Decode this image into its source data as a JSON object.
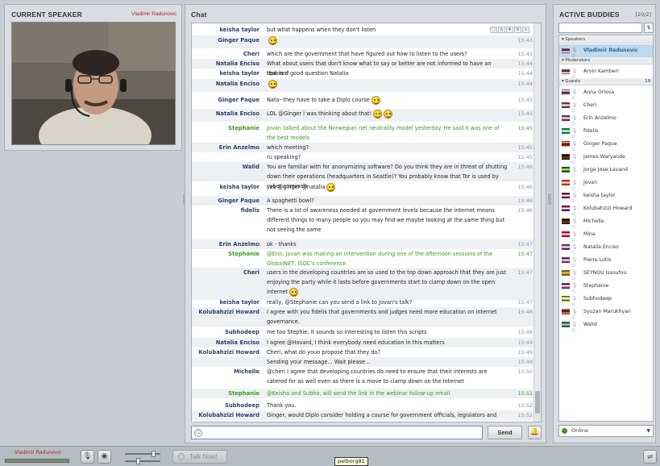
{
  "speaker_panel": {
    "title": "CURRENT SPEAKER",
    "speaker_name": "Vladimir Radunovic"
  },
  "chat_panel": {
    "title": "Chat",
    "send_label": "Send",
    "messages": [
      {
        "name": "keisha taylor",
        "text": "but what happens when they don't listen",
        "time": "",
        "style": "normal"
      },
      {
        "name": "Ginger Paque",
        "text": "",
        "smileys": 1,
        "time": "15:43",
        "style": "normal"
      },
      {
        "name": "Cheri",
        "text": "which are the government that have figured out how to listen to the users?",
        "time": "15:43",
        "style": "normal"
      },
      {
        "name": "Natalia Enciso",
        "text": "What about users that don't know what to say or better are not informed to have an opinion?",
        "time": "15:44",
        "style": "normal"
      },
      {
        "name": "keisha taylor",
        "text": "that is a good question Natalia",
        "time": "15:44",
        "style": "normal"
      },
      {
        "name": "Natalia Enciso",
        "text": "",
        "smileys": 1,
        "time": "15:44",
        "style": "normal"
      },
      {
        "name": "Ginger Paque",
        "text": "Nata--they have to take a Diplo course",
        "smileys": 1,
        "time": "15:45",
        "style": "normal"
      },
      {
        "name": "Natalia Enciso",
        "text": "LOL @Ginger I was thinking about that!",
        "smileys": 2,
        "time": "15:45",
        "style": "normal"
      },
      {
        "name": "Stephanie",
        "text": "Jovan talked about the Norwegian net neutrality model yesterday. He said it was one of the best models",
        "time": "15:45",
        "style": "green"
      },
      {
        "name": "Erin Anzelmo",
        "text": "which meeting?",
        "time": "15:45",
        "style": "normal"
      },
      {
        "name": "",
        "text": "ru speaking?",
        "time": "15:45",
        "style": "normal"
      },
      {
        "name": "Walid",
        "text": "You are familiar with for anonymizing software? Do you think they are in threat of shutting down their operations (headquarters in Seattle)? You probably know that Tor is used by cyber criminals",
        "time": "15:46",
        "style": "normal"
      },
      {
        "name": "keisha taylor",
        "text": "yes @ginger @natalia",
        "smileys": 1,
        "time": "15:46",
        "style": "normal"
      },
      {
        "name": "Ginger Paque",
        "text": "A spaghetti bowl?",
        "time": "15:46",
        "style": "normal"
      },
      {
        "name": "fidelis",
        "text": "There is a lot of awareness needed at government levels because the internet means different things to many people so you may find we maybe looking at the same thing but not seeing the same",
        "time": "15:46",
        "style": "normal"
      },
      {
        "name": "Erin Anzelmo",
        "text": "ok - thanks",
        "time": "15:47",
        "style": "normal"
      },
      {
        "name": "Stephanie",
        "text": "@Erin, Jovan was making an intervention during one of the afternoon sessions of the GlobalNET, ISOC's conference",
        "time": "15:47",
        "style": "green"
      },
      {
        "name": "Cheri",
        "text": "users in the developing countries are so used to the top down approach that they are just enjoying the party while it lasts before governments start to clamp down on the open internet",
        "smileys": 1,
        "time": "15:47",
        "style": "normal"
      },
      {
        "name": "keisha taylor",
        "text": "really, @Stephanie can you send a link to Jovan's talk?",
        "time": "15:47",
        "style": "normal"
      },
      {
        "name": "Kolubahzizi Howard",
        "text": "I agree with you fidelis that governments and judges need more education on internet governance.",
        "time": "15:48",
        "style": "normal"
      },
      {
        "name": "Subhodeep",
        "text": "me too Stephie, it sounds so interesting to listen this scripts",
        "time": "15:48",
        "style": "normal"
      },
      {
        "name": "Natalia Enciso",
        "text": "I agree @Hovard, I think everybody need education in this matters",
        "time": "15:49",
        "style": "normal"
      },
      {
        "name": "Kolubahzizi Howard",
        "text": "Cheri, what do youo propose that they do?",
        "time": "15:49",
        "style": "normal"
      },
      {
        "name": "",
        "text": "Sending your message... Wait please...",
        "time": "15:49",
        "style": "normal"
      },
      {
        "name": "Michelle",
        "text": "@cheri I agree that developing countries do need to ensure that their interests are catered for as well even as there is a move to clamp down on the Internet",
        "time": "15:50",
        "style": "normal"
      },
      {
        "name": "Stephanie",
        "text": "@Keisha and Subho, will send the link in the webinar follow-up email",
        "time": "15:51",
        "style": "green"
      },
      {
        "name": "Subhodeep",
        "text": "Thank you.",
        "time": "15:52",
        "style": "normal"
      },
      {
        "name": "Kolubahzizi Howard",
        "text": "Ginger, would Diplo consider holding a course for government officials, legislators and judges?",
        "time": "15:52",
        "style": "normal"
      }
    ]
  },
  "buddies_panel": {
    "title": "ACTIVE BUDDIES",
    "count": "[20/2]",
    "status": "Online",
    "groups": [
      {
        "label": "Speakers",
        "count": ""
      },
      {
        "label": "Moderators",
        "count": ""
      },
      {
        "label": "Guests",
        "count": "19"
      }
    ],
    "speakers": [
      "Vladimir Radunovic"
    ],
    "moderators": [
      "Arvin Kamberi"
    ],
    "guests": [
      "Anna Orlova",
      "Cheri",
      "Erin Anzelmo",
      "fidelis",
      "Ginger Paque",
      "James Waryande",
      "Jorge Jose Lavand",
      "Jovan",
      "keisha taylor",
      "Kolubahzizi Howard",
      "Michelle",
      "Mina",
      "Natalia Enciso",
      "Pierre Lotis",
      "SEYNOU Issoufou",
      "Stephanie",
      "Subhodeep",
      "Syuzan Marukhyan",
      "Walid"
    ]
  },
  "bottom_bar": {
    "speaker_name": "Vladimir Radunovic",
    "talk_label": "Talk Now!",
    "tooltip": "petborg81"
  },
  "colors": {
    "speaker_name": "#b32020",
    "green_msg": "#3a9a24",
    "name_blue": "#2d3f6a",
    "selected": "#bfd9ee"
  },
  "icons": [
    "microphone-icon",
    "webcam-icon",
    "smiley-icon",
    "bell-icon",
    "share-icon",
    "sort-icon",
    "status-icon"
  ]
}
